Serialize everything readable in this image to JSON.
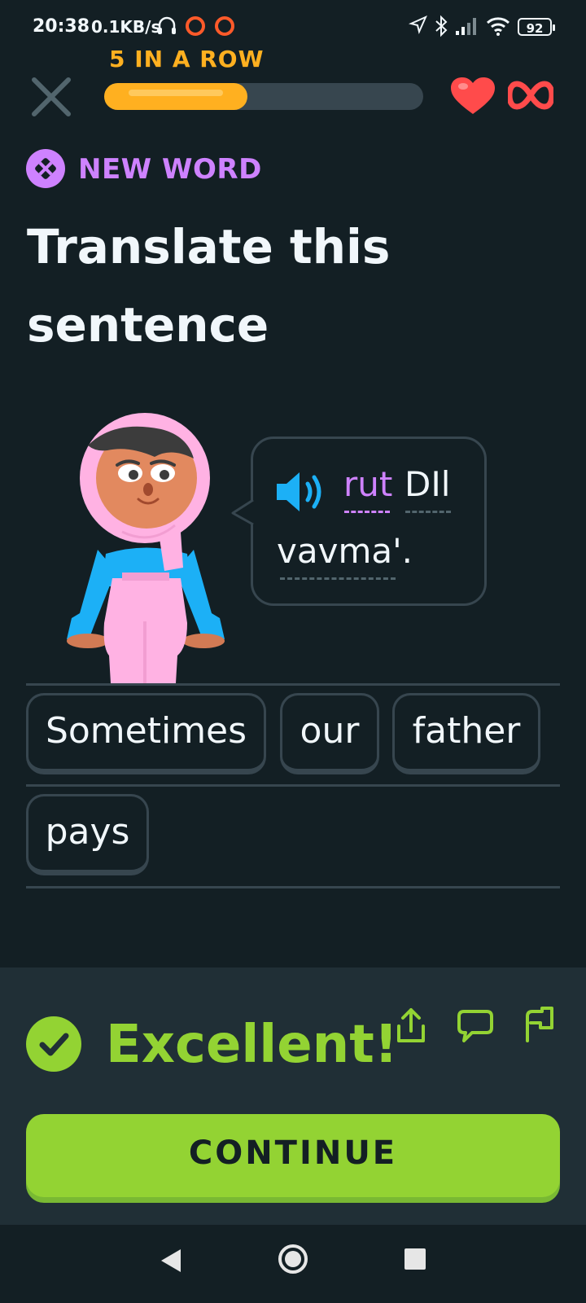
{
  "status_bar": {
    "time": "20:38",
    "speed": "0.1KB/s",
    "battery": "92"
  },
  "header": {
    "streak_label": "5 IN A ROW",
    "progress_fraction": 0.45,
    "lives": "infinite"
  },
  "challenge": {
    "badge_label": "NEW WORD",
    "title": "Translate this sentence",
    "prompt_tokens": [
      "rut",
      "DIl",
      "vavma'."
    ]
  },
  "answer": {
    "words": [
      "Sometimes",
      "our",
      "father",
      "pays"
    ]
  },
  "feedback": {
    "message": "Excellent!",
    "continue_label": "CONTINUE"
  },
  "colors": {
    "background": "#131f24",
    "accent_green": "#93d333",
    "new_word_purple": "#ce82ff",
    "streak_orange": "#ffb020",
    "heart_red": "#ff4b4b",
    "speaker_blue": "#1cb0f6"
  },
  "icons": [
    "close-icon",
    "heart-icon",
    "infinity-icon",
    "new-word-icon",
    "speaker-icon",
    "check-icon",
    "share-icon",
    "comment-icon",
    "flag-icon",
    "back-icon",
    "home-icon",
    "recents-icon"
  ]
}
